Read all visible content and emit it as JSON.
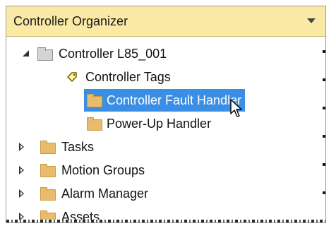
{
  "panel": {
    "title": "Controller Organizer",
    "dropdown_icon": "chevron-down-icon"
  },
  "tree": {
    "root": {
      "label": "Controller L85_001",
      "icon": "controller-icon",
      "expanded": true
    },
    "children": [
      {
        "label": "Controller Tags",
        "icon": "tag-icon"
      },
      {
        "label": "Controller Fault Handler",
        "icon": "folder-icon",
        "selected": true
      },
      {
        "label": "Power-Up Handler",
        "icon": "folder-icon"
      }
    ],
    "top_level": [
      {
        "label": "Tasks",
        "icon": "folder-icon",
        "expanded": false
      },
      {
        "label": "Motion Groups",
        "icon": "folder-icon",
        "expanded": false
      },
      {
        "label": "Alarm Manager",
        "icon": "folder-icon",
        "expanded": false
      },
      {
        "label": "Assets",
        "icon": "folder-icon",
        "expanded": false
      }
    ]
  },
  "colors": {
    "header_bg": "#fbe9a6",
    "selection": "#3a8ee6",
    "folder": "#e8bc6b"
  }
}
